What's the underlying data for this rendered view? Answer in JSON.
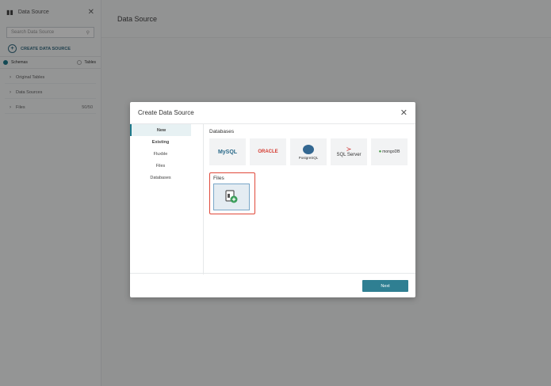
{
  "sidebar": {
    "title": "Data Source",
    "search_placeholder": "Search Data Source",
    "create_label": "CREATE DATA SOURCE",
    "radio": {
      "schemas": "Schemas",
      "tables": "Tables"
    },
    "tree": [
      {
        "label": "Original Tables",
        "count": ""
      },
      {
        "label": "Data Sources",
        "count": ""
      },
      {
        "label": "Files",
        "count": "50/50"
      }
    ]
  },
  "header": {
    "title": "Data Source"
  },
  "modal": {
    "title": "Create Data Source",
    "menu": [
      "New",
      "Existing",
      "Fluxble",
      "Files",
      "Databases"
    ],
    "databases_label": "Databases",
    "databases": [
      "MySQL",
      "ORACLE",
      "PostgreSQL",
      "SQL Server",
      "mongoDB"
    ],
    "files_label": "Files",
    "next_label": "Next"
  },
  "colors": {
    "accent": "#1f7a8c",
    "highlight": "#e0483a"
  }
}
